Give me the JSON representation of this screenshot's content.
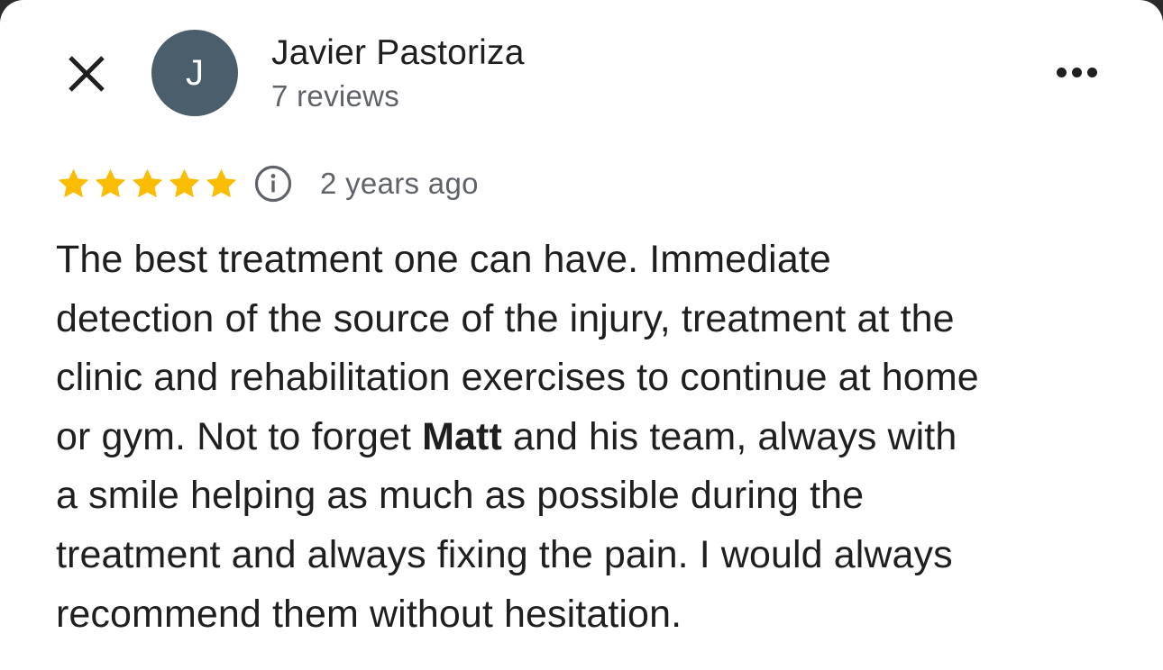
{
  "review": {
    "reviewer": {
      "name": "Javier Pastoriza",
      "initial": "J",
      "review_count": "7 reviews",
      "avatar_color": "#4a5e6b"
    },
    "rating": {
      "value": 5,
      "max": 5,
      "star_color": "#fbbc04"
    },
    "date": "2 years ago",
    "body": {
      "lines": [
        {
          "pre": "The best treatment one can have. Immediate",
          "bold": "",
          "post": ""
        },
        {
          "pre": "detection of the source of the injury, treatment at the",
          "bold": "",
          "post": ""
        },
        {
          "pre": "clinic and rehabilitation exercises to continue at home",
          "bold": "",
          "post": ""
        },
        {
          "pre": "or gym. Not to forget ",
          "bold": "Matt",
          "post": " and his team, always with"
        },
        {
          "pre": "a smile helping as much as possible during the",
          "bold": "",
          "post": ""
        },
        {
          "pre": "treatment and always fixing the pain. I would always",
          "bold": "",
          "post": ""
        },
        {
          "pre": "recommend them without hesitation.",
          "bold": "",
          "post": ""
        }
      ]
    }
  },
  "icons": {
    "close": "close-icon",
    "more": "more-horizontal-icon",
    "info": "info-icon",
    "star": "star-icon"
  }
}
